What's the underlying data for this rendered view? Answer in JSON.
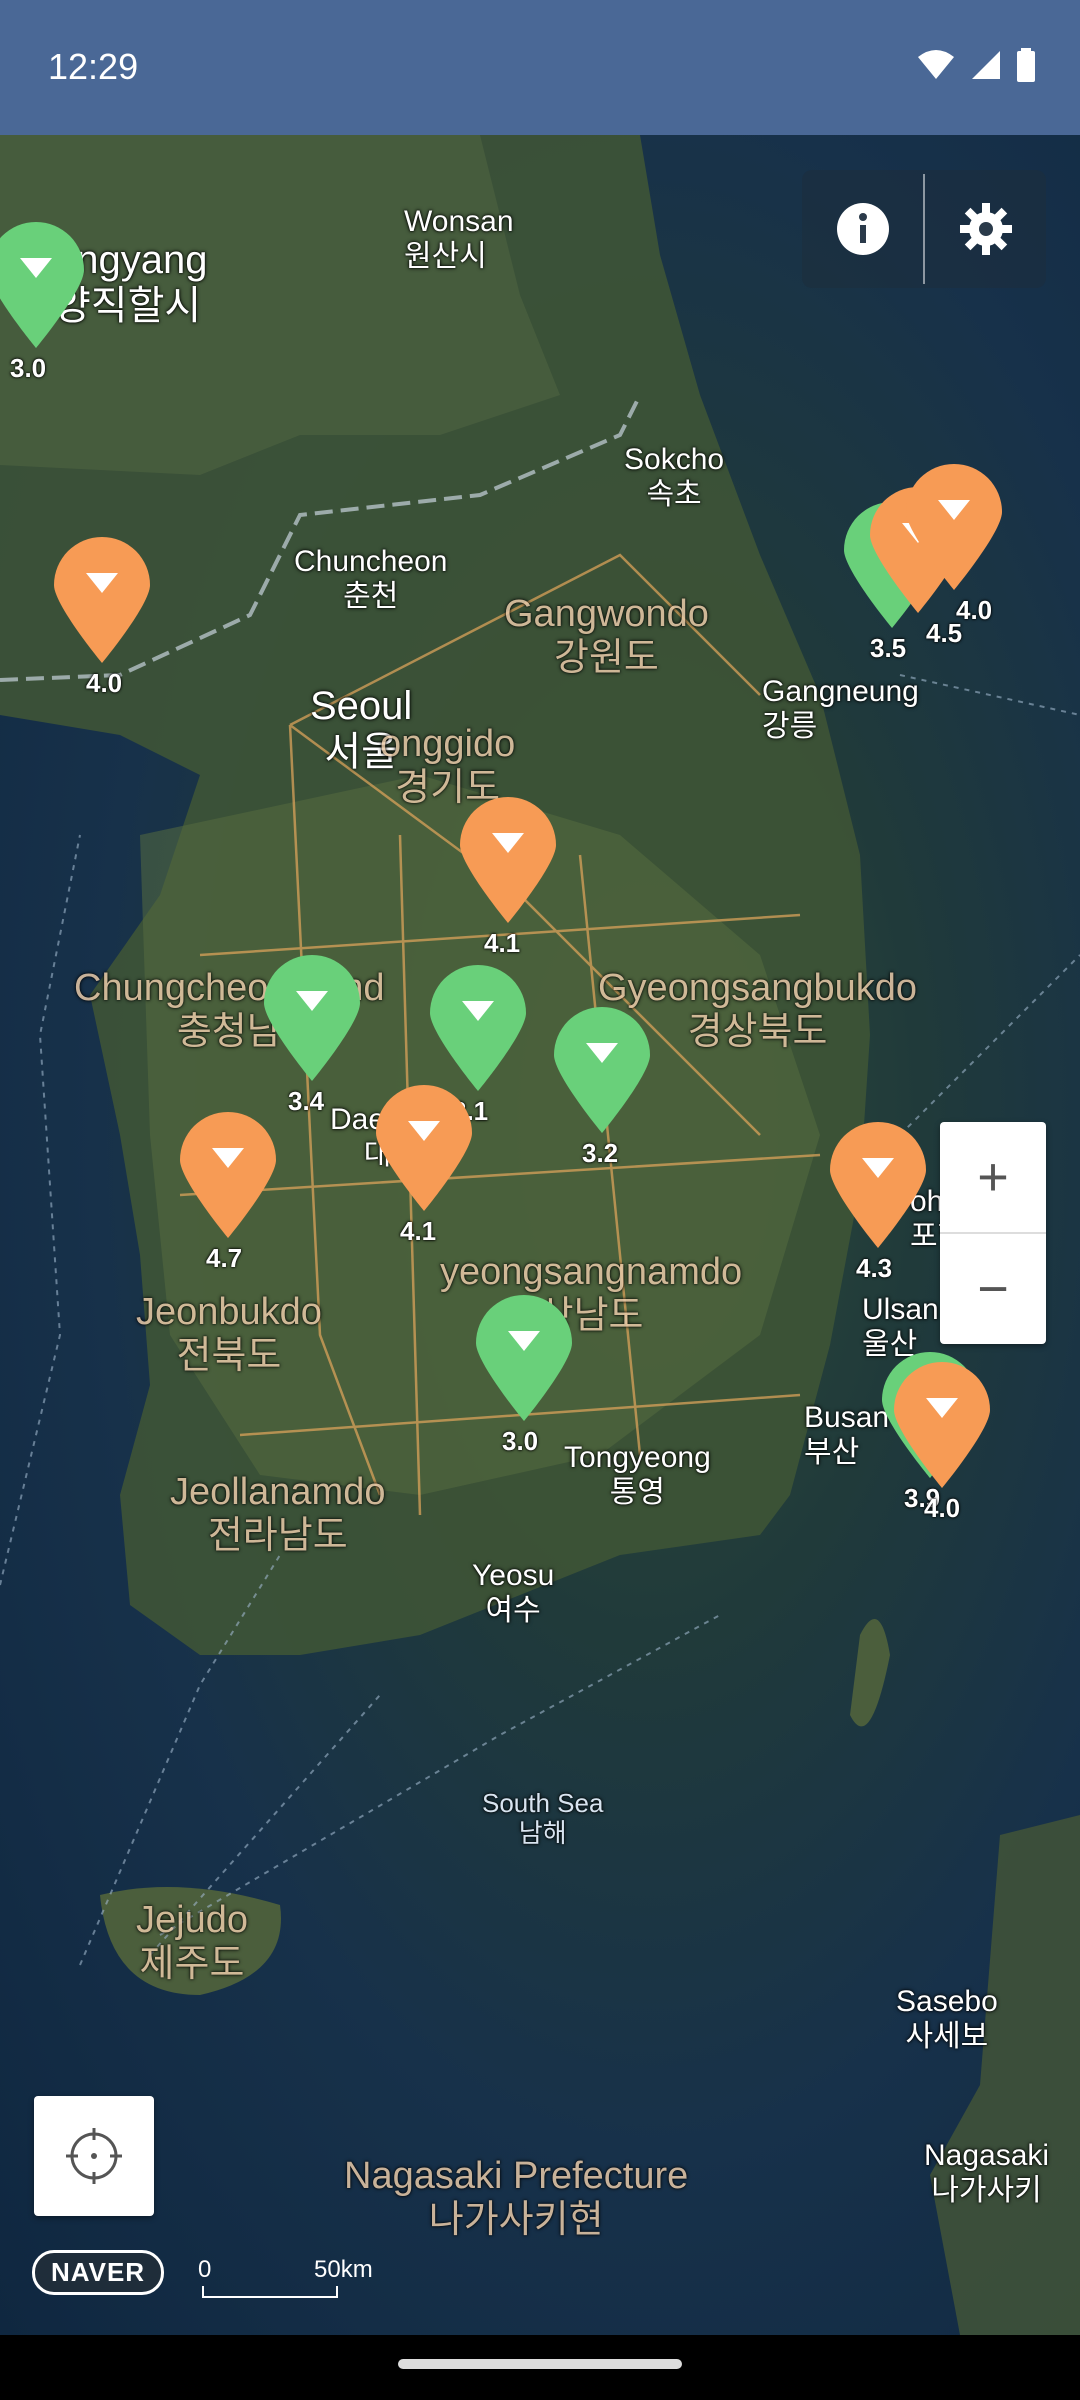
{
  "status": {
    "time": "12:29"
  },
  "colors": {
    "green_pin": "#69d07a",
    "orange_pin": "#f79b55",
    "status_bar": "#4a6896"
  },
  "controls": {
    "info_icon": "info-icon",
    "settings_icon": "gear-icon",
    "zoom_in": "+",
    "zoom_out": "−",
    "locate_icon": "crosshair-icon",
    "brand": "NAVER",
    "scale_start": "0",
    "scale_end": "50km"
  },
  "places": [
    {
      "id": "wonsan",
      "text": "Wonsan\n원산시"
    },
    {
      "id": "pyongyang",
      "text": "ongyang\n양직할시"
    },
    {
      "id": "sokcho",
      "text": "Sokcho\n속초"
    },
    {
      "id": "chuncheon",
      "text": "Chuncheon\n춘천"
    },
    {
      "id": "gangwondo",
      "text": "Gangwondo\n강원도"
    },
    {
      "id": "seoul",
      "text": "Seoul\n서울"
    },
    {
      "id": "gyeonggido",
      "text": "onggido\n경기도"
    },
    {
      "id": "gangneung",
      "text": "Gangneung\n강릉"
    },
    {
      "id": "chungcheongnamdo",
      "text": "Chungcheo    amd\n충청남"
    },
    {
      "id": "gyeongsangbukdo",
      "text": "Gyeongsangbukdo\n경상북도"
    },
    {
      "id": "daejeon",
      "text": "Daejeo\n대"
    },
    {
      "id": "jeonbukdo",
      "text": "Jeonbukdo\n전북도"
    },
    {
      "id": "gyeongsangnamdo",
      "text": "yeongsangnamdo\n상남도"
    },
    {
      "id": "pohang",
      "text": "oha\n포항"
    },
    {
      "id": "ulsan",
      "text": "Ulsan\n울산"
    },
    {
      "id": "busan",
      "text": "Busan\n부산"
    },
    {
      "id": "tongyeong",
      "text": "Tongyeong\n통영"
    },
    {
      "id": "jeollanamdo",
      "text": "Jeollanamdo\n전라남도"
    },
    {
      "id": "yeosu",
      "text": "Yeosu\n여수"
    },
    {
      "id": "south_sea",
      "text": "South Sea\n남해"
    },
    {
      "id": "jejudo",
      "text": "Jejudo\n제주도"
    },
    {
      "id": "sasebo",
      "text": "Sasebo\n사세보"
    },
    {
      "id": "nagasaki",
      "text": "Nagasaki\n나가사키"
    },
    {
      "id": "nagasaki_pref",
      "text": "Nagasaki Prefecture\n나가사키현"
    }
  ],
  "pins": [
    {
      "color": "green",
      "value": "3.0"
    },
    {
      "color": "orange",
      "value": "4.0"
    },
    {
      "color": "green",
      "value": "3.5"
    },
    {
      "color": "orange",
      "value": "4.5"
    },
    {
      "color": "orange",
      "value": "4.0"
    },
    {
      "color": "orange",
      "value": "4.1"
    },
    {
      "color": "green",
      "value": "3.4"
    },
    {
      "color": "green",
      "value": "3.1"
    },
    {
      "color": "green",
      "value": "3.2"
    },
    {
      "color": "orange",
      "value": "4.7"
    },
    {
      "color": "orange",
      "value": "4.1"
    },
    {
      "color": "orange",
      "value": "4.3"
    },
    {
      "color": "green",
      "value": "3.0"
    },
    {
      "color": "green",
      "value": "3.9"
    },
    {
      "color": "orange",
      "value": "4.0"
    }
  ]
}
